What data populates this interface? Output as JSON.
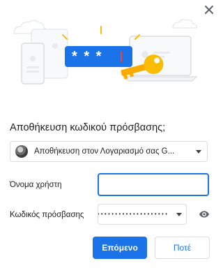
{
  "dialog": {
    "title": "Αποθήκευση κωδικού πρόσβασης;",
    "close_icon": "close-icon",
    "illustration_mask": "* * *"
  },
  "account": {
    "label": "Αποθήκευση στον Λογαριασμό σας G...",
    "avatar_icon": "user-avatar"
  },
  "form": {
    "username_label": "Όνομα χρήστη",
    "username_value": "",
    "password_label": "Κωδικός πρόσβασης",
    "password_value": "••••••••••••••••••••"
  },
  "buttons": {
    "next_label": "Επόμενο",
    "never_label": "Ποτέ"
  },
  "colors": {
    "accent": "#1a73e8",
    "key": "#fbbc04"
  }
}
